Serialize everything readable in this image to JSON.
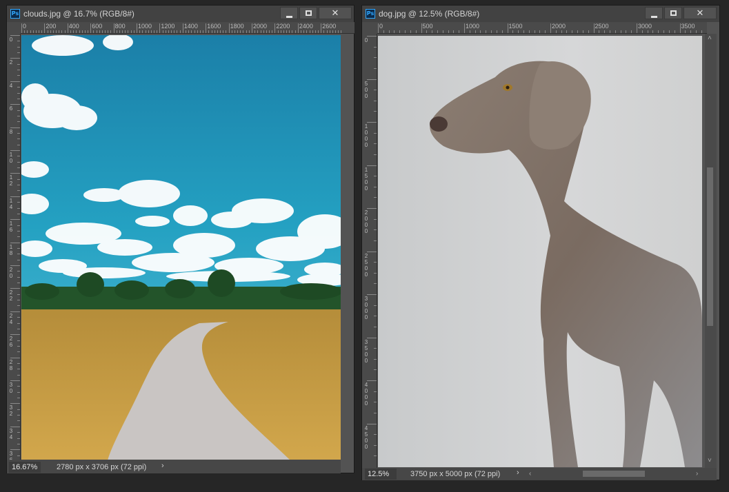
{
  "windows": {
    "clouds": {
      "title": "clouds.jpg @ 16.7% (RGB/8#)",
      "ps_badge": "Ps",
      "ruler_h": [
        "0",
        "200",
        "400",
        "600",
        "800",
        "1000",
        "1200",
        "1400",
        "1600",
        "1800",
        "2000",
        "2200",
        "2400",
        "2600"
      ],
      "ruler_v": [
        "0",
        "2",
        "4",
        "6",
        "8",
        "1 0",
        "1 2",
        "1 4",
        "1 6",
        "1 8",
        "2 0",
        "2 2",
        "2 4",
        "2 6",
        "2 8",
        "3 0",
        "3 2",
        "3 4",
        "3 6"
      ],
      "zoom": "16.67%",
      "doc_info": "2780 px x 3706 px (72 ppi)"
    },
    "dog": {
      "title": "dog.jpg @ 12.5% (RGB/8#)",
      "ps_badge": "Ps",
      "ruler_h": [
        "0",
        "500",
        "1000",
        "1500",
        "2000",
        "2500",
        "3000",
        "3500"
      ],
      "ruler_v": [
        "0",
        "5 0 0",
        "1 0 0 0",
        "1 5 0 0",
        "2 0 0 0",
        "2 5 0 0",
        "3 0 0 0",
        "3 5 0 0",
        "4 0 0 0",
        "4 5 0 0"
      ],
      "zoom": "12.5%",
      "doc_info": "3750 px x 5000 px (72 ppi)"
    }
  },
  "icons": {
    "minimize": "minimize-icon",
    "maximize": "maximize-icon",
    "close": "close-icon",
    "chevron": "chevron-right-icon"
  },
  "glyphs": {
    "close": "✕",
    "chevron_right": "›",
    "chevron_left": "‹",
    "chevron_up": "˄",
    "chevron_down": "˅"
  },
  "colors": {
    "workspace": "#262626",
    "panel": "#535353",
    "ruler": "#4a4a4a",
    "sky": "#1f93b5",
    "field": "#c9a24a",
    "wall": "#cfd0d1",
    "dog": "#7b6d63"
  }
}
